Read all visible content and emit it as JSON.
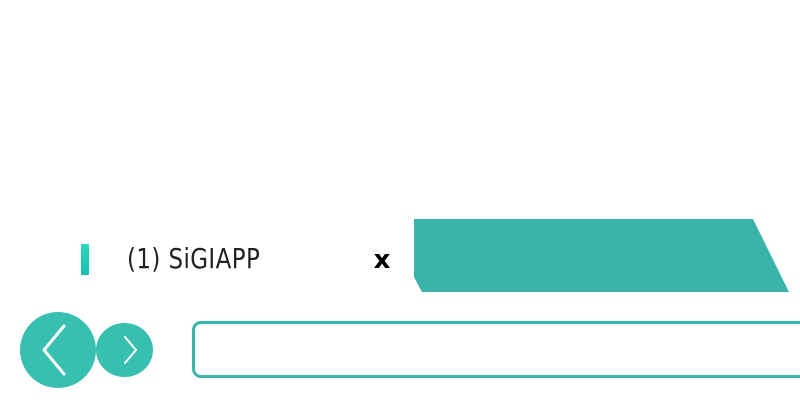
{
  "tab": {
    "title": "(1) SiGIAPP",
    "close_label": "x",
    "favicon_color": "#18c9b6"
  },
  "new_tab": {
    "icon": "new-tab-shape",
    "color": "#3ab3a9"
  },
  "navigation": {
    "back_icon": "chevron-left-icon",
    "forward_icon": "chevron-right-icon",
    "color": "#37bfb0"
  },
  "address_bar": {
    "value": "",
    "placeholder": "",
    "border_color": "#3bb3a8"
  }
}
